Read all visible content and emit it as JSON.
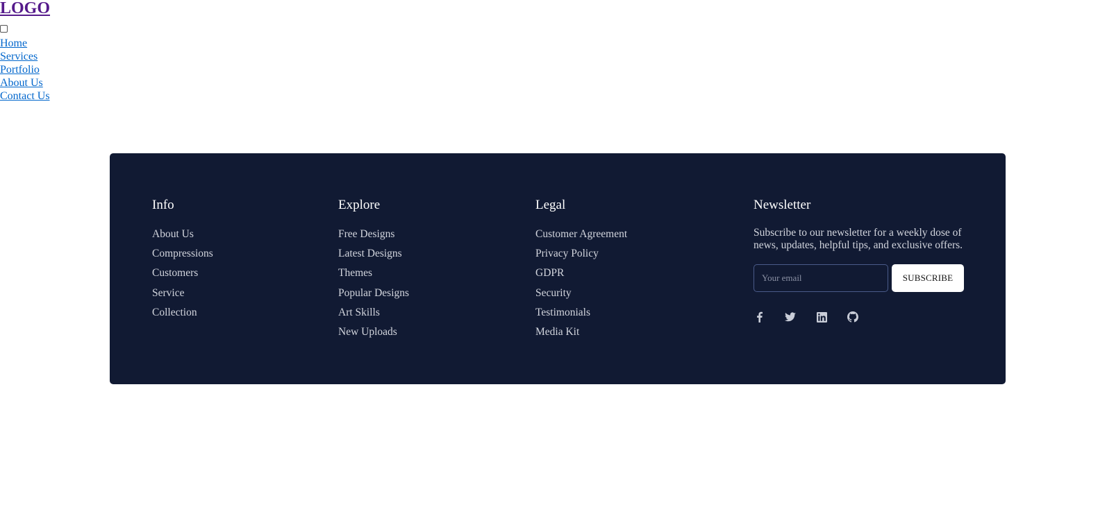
{
  "nav": {
    "logo": "LOGO",
    "links": [
      "Home",
      "Services",
      "Portfolio",
      "About Us",
      "Contact Us"
    ]
  },
  "footer": {
    "info": {
      "title": "Info",
      "items": [
        "About Us",
        "Compressions",
        "Customers",
        "Service",
        "Collection"
      ]
    },
    "explore": {
      "title": "Explore",
      "items": [
        "Free Designs",
        "Latest Designs",
        "Themes",
        "Popular Designs",
        "Art Skills",
        "New Uploads"
      ]
    },
    "legal": {
      "title": "Legal",
      "items": [
        "Customer Agreement",
        "Privacy Policy",
        "GDPR",
        "Security",
        "Testimonials",
        "Media Kit"
      ]
    },
    "newsletter": {
      "title": "Newsletter",
      "text": "Subscribe to our newsletter for a weekly dose of news, updates, helpful tips, and exclusive offers.",
      "email_placeholder": "Your email",
      "email_value": "",
      "subscribe_label": "SUBSCRIBE",
      "socials": [
        "facebook-icon",
        "twitter-icon",
        "linkedin-icon",
        "github-icon"
      ]
    }
  },
  "colors": {
    "footer_bg": "#111a33",
    "footer_text": "#d2d5dd",
    "logo": "#551a8b",
    "link": "#0066cc"
  }
}
